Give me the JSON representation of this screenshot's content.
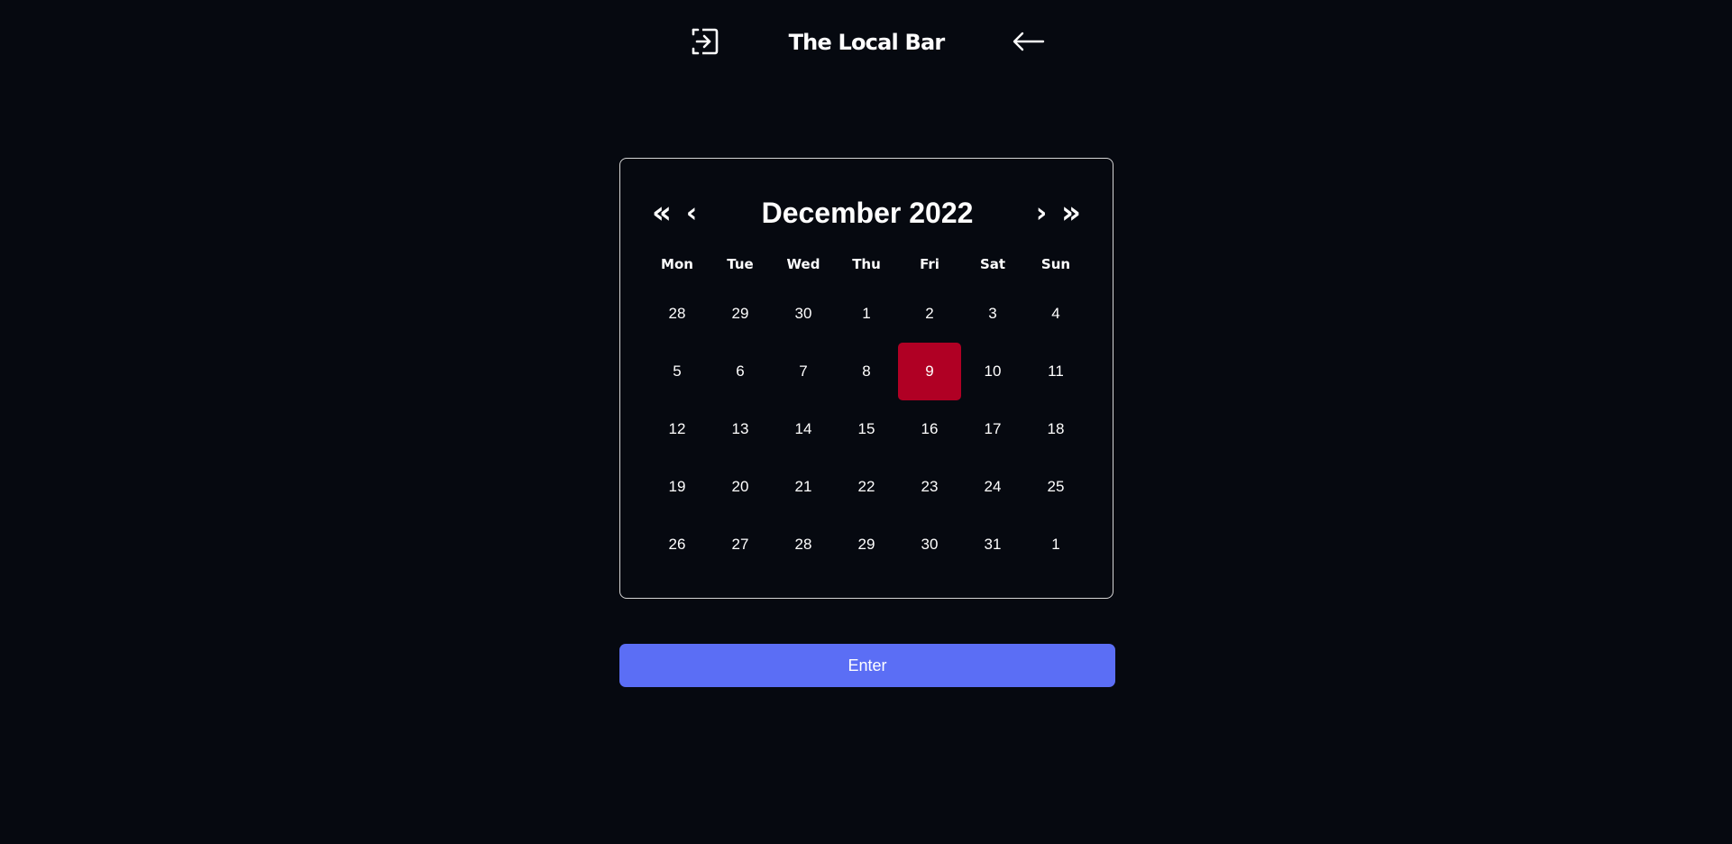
{
  "header": {
    "title": "The Local Bar",
    "login_icon": "login-icon",
    "back_icon": "arrow-left-icon"
  },
  "calendar": {
    "month_label": "December 2022",
    "nav": {
      "prev_year": "«",
      "prev_month": "‹",
      "next_month": "›",
      "next_year": "»"
    },
    "weekdays": [
      "Mon",
      "Tue",
      "Wed",
      "Thu",
      "Fri",
      "Sat",
      "Sun"
    ],
    "days": [
      "28",
      "29",
      "30",
      "1",
      "2",
      "3",
      "4",
      "5",
      "6",
      "7",
      "8",
      "9",
      "10",
      "11",
      "12",
      "13",
      "14",
      "15",
      "16",
      "17",
      "18",
      "19",
      "20",
      "21",
      "22",
      "23",
      "24",
      "25",
      "26",
      "27",
      "28",
      "29",
      "30",
      "31",
      "1"
    ],
    "selected_day": "9",
    "selected_color": "#b00024"
  },
  "actions": {
    "enter_label": "Enter",
    "enter_color": "#5b6ef5"
  },
  "colors": {
    "background": "#060910",
    "text": "#ffffff",
    "calendar_border": "#d6d6d6"
  }
}
